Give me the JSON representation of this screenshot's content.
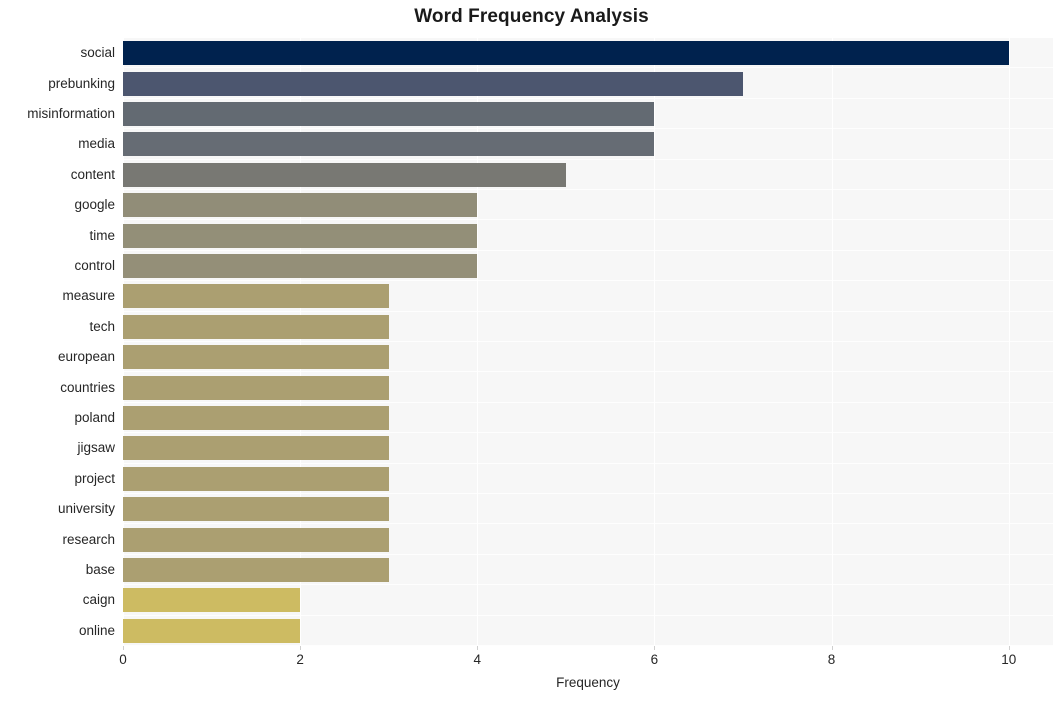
{
  "chart_data": {
    "type": "bar",
    "orientation": "horizontal",
    "title": "Word Frequency Analysis",
    "xlabel": "Frequency",
    "ylabel": "",
    "xlim": [
      0,
      10.5
    ],
    "xticks": [
      0,
      2,
      4,
      6,
      8,
      10
    ],
    "xticklabels": [
      "0",
      "2",
      "4",
      "6",
      "8",
      "10"
    ],
    "grid": true,
    "grid_color": "#ffffff",
    "plot_background": "#f7f7f7",
    "figure_background": "#ffffff",
    "legend": null,
    "colormap": "cividis",
    "categories": [
      "social",
      "prebunking",
      "misinformation",
      "media",
      "content",
      "google",
      "time",
      "control",
      "measure",
      "tech",
      "european",
      "countries",
      "poland",
      "jigsaw",
      "project",
      "university",
      "research",
      "base",
      "caign",
      "online"
    ],
    "values": [
      10,
      7,
      6,
      6,
      5,
      4,
      4,
      4,
      3,
      3,
      3,
      3,
      3,
      3,
      3,
      3,
      3,
      3,
      2,
      2
    ],
    "colors": [
      "#00224e",
      "#4c566f",
      "#636a72",
      "#666c74",
      "#787873",
      "#918d78",
      "#938f78",
      "#948f78",
      "#ab9f71",
      "#ab9f71",
      "#ab9f71",
      "#ab9f71",
      "#ab9f71",
      "#ab9f71",
      "#ab9f71",
      "#ab9f71",
      "#ab9f71",
      "#ab9f71",
      "#cdbb62",
      "#cdbb62"
    ]
  }
}
